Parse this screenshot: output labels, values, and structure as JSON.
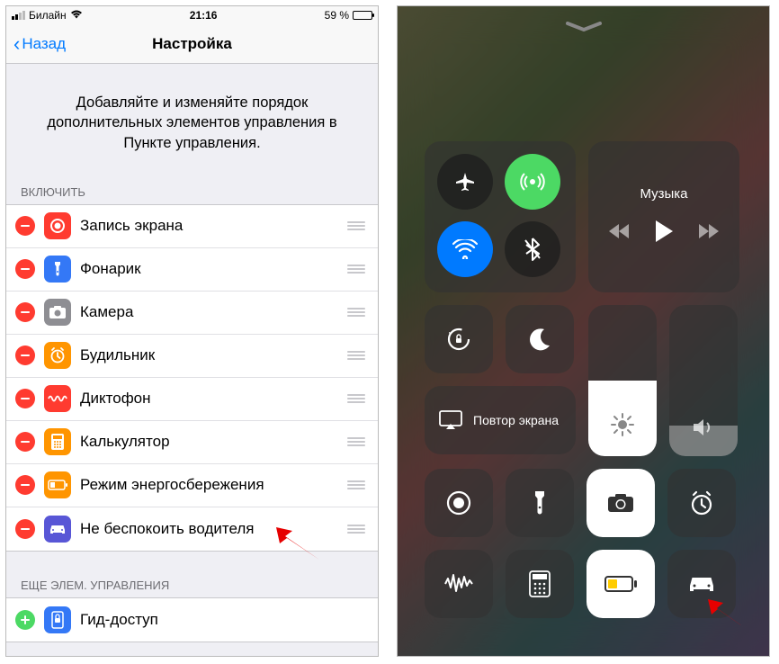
{
  "left": {
    "status": {
      "carrier": "Билайн",
      "time": "21:16",
      "battery_pct": "59 %"
    },
    "nav": {
      "back": "Назад",
      "title": "Настройка"
    },
    "intro": "Добавляйте и изменяйте порядок дополнительных элементов управления в Пункте управления.",
    "section_include": "ВКЛЮЧИТЬ",
    "include_items": [
      {
        "label": "Запись экрана",
        "icon": "record"
      },
      {
        "label": "Фонарик",
        "icon": "flashlight"
      },
      {
        "label": "Камера",
        "icon": "camera"
      },
      {
        "label": "Будильник",
        "icon": "alarm"
      },
      {
        "label": "Диктофон",
        "icon": "voice"
      },
      {
        "label": "Калькулятор",
        "icon": "calculator"
      },
      {
        "label": "Режим энергосбережения",
        "icon": "lowpower"
      },
      {
        "label": "Не беспокоить водителя",
        "icon": "car"
      }
    ],
    "section_more": "ЕЩЕ ЭЛЕМ. УПРАВЛЕНИЯ",
    "more_items": [
      {
        "label": "Гид-доступ",
        "icon": "guided"
      }
    ]
  },
  "right": {
    "music_label": "Музыка",
    "screen_mirror_label": "Повтор экрана",
    "brightness_pct": 50,
    "volume_pct": 20,
    "toggles": {
      "airplane": false,
      "cellular": true,
      "wifi": true,
      "bluetooth": false,
      "lock_rotation": false,
      "dnd": false
    },
    "bottom_tiles": [
      "screen-record",
      "flashlight",
      "camera",
      "alarm",
      "voice-memo",
      "calculator",
      "low-power",
      "driving-dnd"
    ]
  },
  "colors": {
    "ios_blue": "#007aff",
    "ios_red": "#ff3b30",
    "ios_green": "#4cd964",
    "ios_orange": "#ff9500",
    "ios_purple": "#5856d6",
    "ios_yellow": "#ffcc00"
  }
}
